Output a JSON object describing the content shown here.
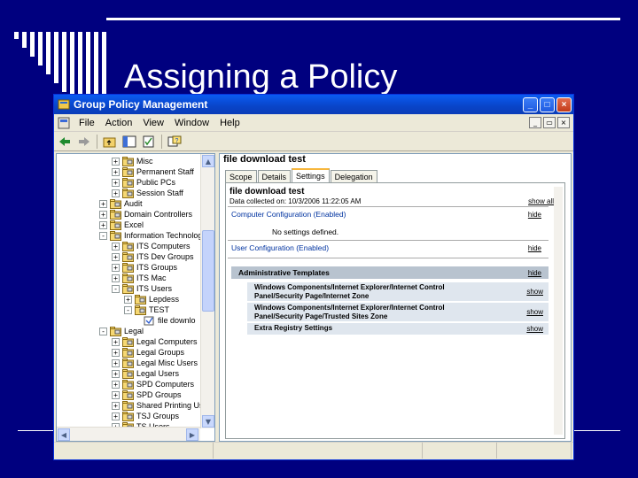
{
  "slide": {
    "title": "Assigning a Policy"
  },
  "window": {
    "title": "Group Policy Management",
    "controls": {
      "minimize": "_",
      "maximize": "□",
      "close": "×"
    }
  },
  "menu": [
    "File",
    "Action",
    "View",
    "Window",
    "Help"
  ],
  "tree": [
    {
      "label": "Misc",
      "expander": "+"
    },
    {
      "label": "Permanent Staff",
      "expander": "+"
    },
    {
      "label": "Public PCs",
      "expander": "+"
    },
    {
      "label": "Session Staff",
      "expander": "+"
    },
    {
      "label": "Audit",
      "expander": "+"
    },
    {
      "label": "Domain Controllers",
      "expander": "+"
    },
    {
      "label": "Excel",
      "expander": "+"
    },
    {
      "label": "Information Technology",
      "expander": "-"
    },
    {
      "label": "ITS Computers",
      "expander": "+"
    },
    {
      "label": "ITS Dev Groups",
      "expander": "+"
    },
    {
      "label": "ITS Groups",
      "expander": "+"
    },
    {
      "label": "ITS Mac",
      "expander": "+"
    },
    {
      "label": "ITS Users",
      "expander": "-"
    },
    {
      "label": "Lepdess",
      "expander": "+"
    },
    {
      "label": "TEST",
      "expander": "-"
    },
    {
      "label": "file downlo",
      "expander": ""
    },
    {
      "label": "Legal",
      "expander": "-"
    },
    {
      "label": "Legal Computers",
      "expander": "+"
    },
    {
      "label": "Legal Groups",
      "expander": "+"
    },
    {
      "label": "Legal Misc Users",
      "expander": "+"
    },
    {
      "label": "Legal Users",
      "expander": "+"
    },
    {
      "label": "SPD Computers",
      "expander": "+"
    },
    {
      "label": "SPD Groups",
      "expander": "+"
    },
    {
      "label": "Shared Printing Users",
      "expander": "+"
    },
    {
      "label": "TSJ Groups",
      "expander": "+"
    },
    {
      "label": "TS Users",
      "expander": "+"
    }
  ],
  "right_pane": {
    "heading": "file download test",
    "tabs": [
      "Scope",
      "Details",
      "Settings",
      "Delegation"
    ],
    "active_tab": "Settings",
    "report": {
      "title": "file download test",
      "date": "Data collected on: 10/3/2006 11:22:05 AM",
      "show_all": "show all",
      "computer_section": "Computer Configuration (Enabled)",
      "computer_link": "hide",
      "no_settings": "No settings defined.",
      "user_section": "User Configuration (Enabled)",
      "user_link": "hide",
      "admin_templates": "Administrative Templates",
      "admin_link": "hide",
      "items": [
        {
          "label": "Windows Components/Internet Explorer/Internet Control Panel/Security Page/Internet Zone",
          "link": "show"
        },
        {
          "label": "Windows Components/Internet Explorer/Internet Control Panel/Security Page/Trusted Sites Zone",
          "link": "show"
        },
        {
          "label": "Extra Registry Settings",
          "link": "show"
        }
      ]
    }
  }
}
